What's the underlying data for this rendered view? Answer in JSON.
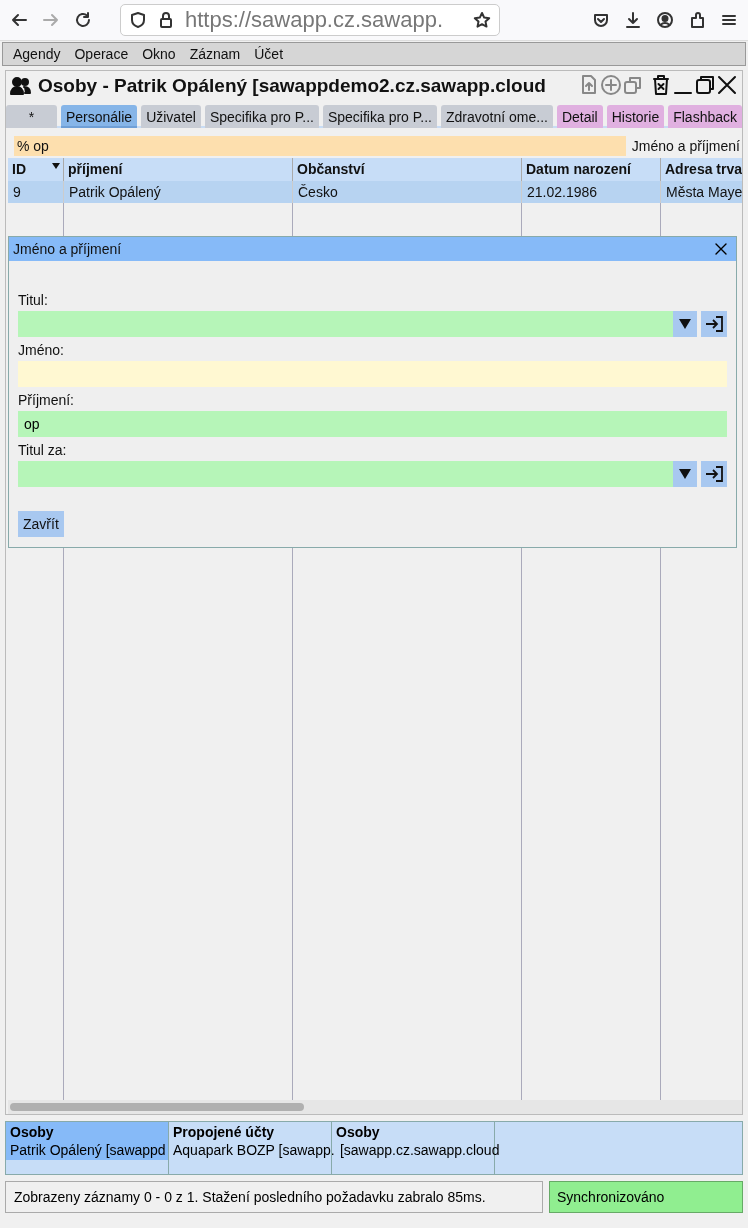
{
  "browser": {
    "url": "https://sawapp.cz.sawapp."
  },
  "menu": [
    "Agendy",
    "Operace",
    "Okno",
    "Záznam",
    "Účet"
  ],
  "window": {
    "title": "Osoby - Patrik Opálený [sawappdemo2.cz.sawapp.cloud"
  },
  "tabs": [
    {
      "label": "*",
      "selected": false,
      "color": "#c8ccd4"
    },
    {
      "label": "Personálie",
      "selected": true,
      "color": "#86b5e8"
    },
    {
      "label": "Uživatel",
      "selected": false,
      "color": "#c8ccd4"
    },
    {
      "label": "Specifika pro P...",
      "selected": false,
      "color": "#c8ccd4"
    },
    {
      "label": "Specifika pro P...",
      "selected": false,
      "color": "#c8ccd4"
    },
    {
      "label": "Zdravotní ome...",
      "selected": false,
      "color": "#c8ccd4"
    },
    {
      "label": "Detail",
      "selected": false,
      "color": "#e0b0e0"
    },
    {
      "label": "Historie",
      "selected": false,
      "color": "#e0b0e0"
    },
    {
      "label": "Flashback",
      "selected": false,
      "color": "#e0b0e0"
    }
  ],
  "filter": {
    "value": "% op",
    "label": "Jméno a příjmení"
  },
  "table": {
    "columns": [
      {
        "label": "ID",
        "sorted": true
      },
      {
        "label": "příjmení",
        "sorted": false
      },
      {
        "label": "Občanství",
        "sorted": false
      },
      {
        "label": "Datum narození",
        "sorted": false
      },
      {
        "label": "Adresa trva",
        "sorted": false
      }
    ],
    "rows": [
      {
        "selected": true,
        "cells": [
          "9",
          "Patrik Opálený",
          "Česko",
          "21.02.1986",
          "Města Maye"
        ]
      }
    ]
  },
  "dialog": {
    "title": "Jméno a příjmení",
    "fields": [
      {
        "label": "Titul:",
        "kind": "select",
        "color": "#b6f5b8"
      },
      {
        "label": "Jméno:",
        "kind": "text",
        "color": "#fff8d2"
      },
      {
        "label": "Příjmení:",
        "kind": "text",
        "value": "op",
        "color": "#b6f5b8"
      },
      {
        "label": "Titul za:",
        "kind": "select",
        "color": "#b6f5b8"
      }
    ],
    "button": "Zavřít"
  },
  "taskbar": [
    {
      "title": "Osoby",
      "subtitle": "Patrik Opálený [sawappd",
      "selected": true
    },
    {
      "title": "Propojené účty",
      "subtitle": "Aquapark BOZP [sawapp.",
      "selected": false
    },
    {
      "title": "Osoby",
      "subtitle": " [sawapp.cz.sawapp.cloud",
      "selected": false
    }
  ],
  "status_bar": {
    "message": "Zobrazeny záznamy 0 - 0 z 1. Stažení posledního požadavku zabralo 85ms.",
    "sync": "Synchronizováno"
  }
}
